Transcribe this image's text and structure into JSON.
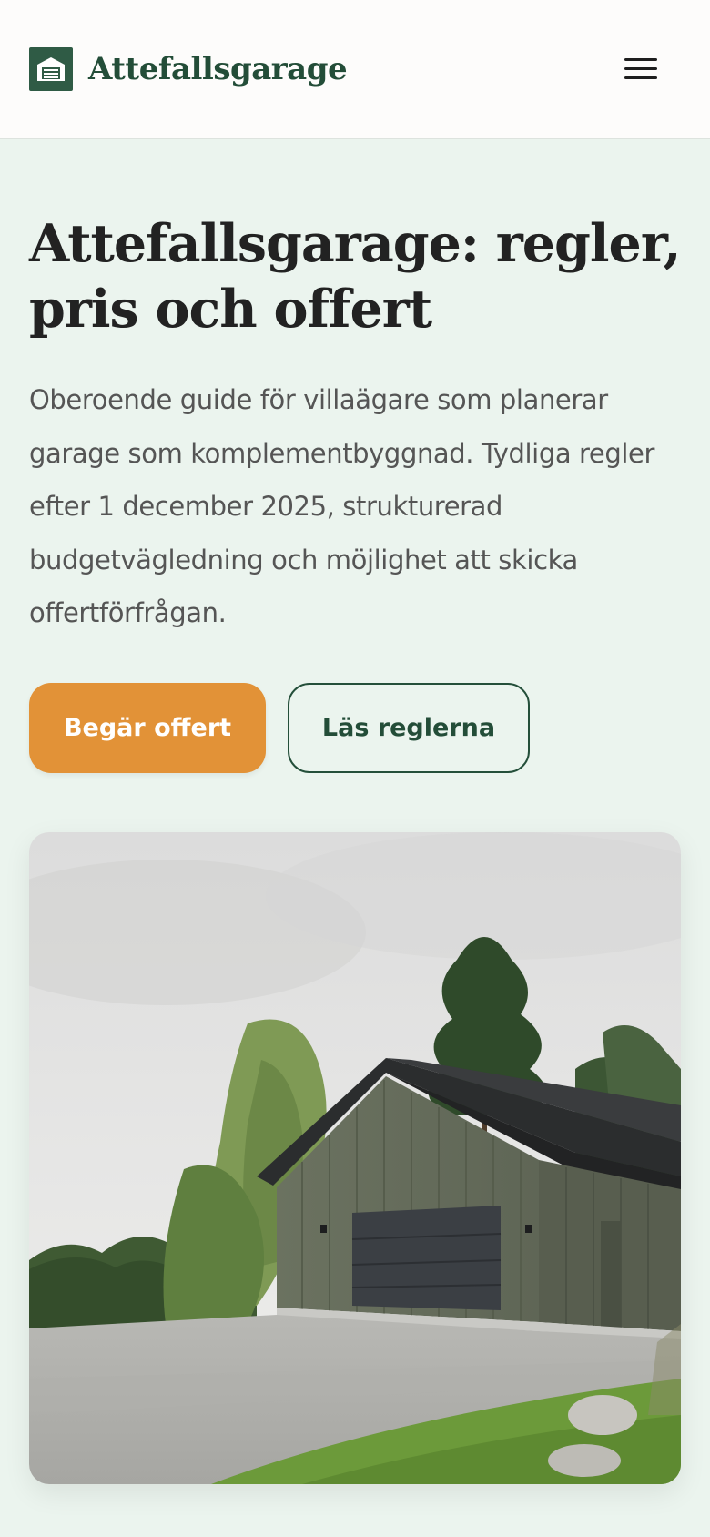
{
  "header": {
    "brand_name": "Attefallsgarage",
    "logo_icon": "garage-icon",
    "menu_icon": "hamburger-menu-icon"
  },
  "hero": {
    "title": "Attefallsgarage: regler, pris och offert",
    "lead": "Oberoende guide för villaägare som planerar garage som komplementbyggnad. Tydliga regler efter 1 december 2025, strukturerad budgetvägledning och möjlighet att skicka offertförfrågan.",
    "primary_button": "Begär offert",
    "secondary_button": "Läs reglerna"
  },
  "colors": {
    "brand_green": "#2f5b45",
    "accent_orange": "#e29237",
    "page_background": "#ebf4ee",
    "header_background": "#fdfcfb"
  }
}
